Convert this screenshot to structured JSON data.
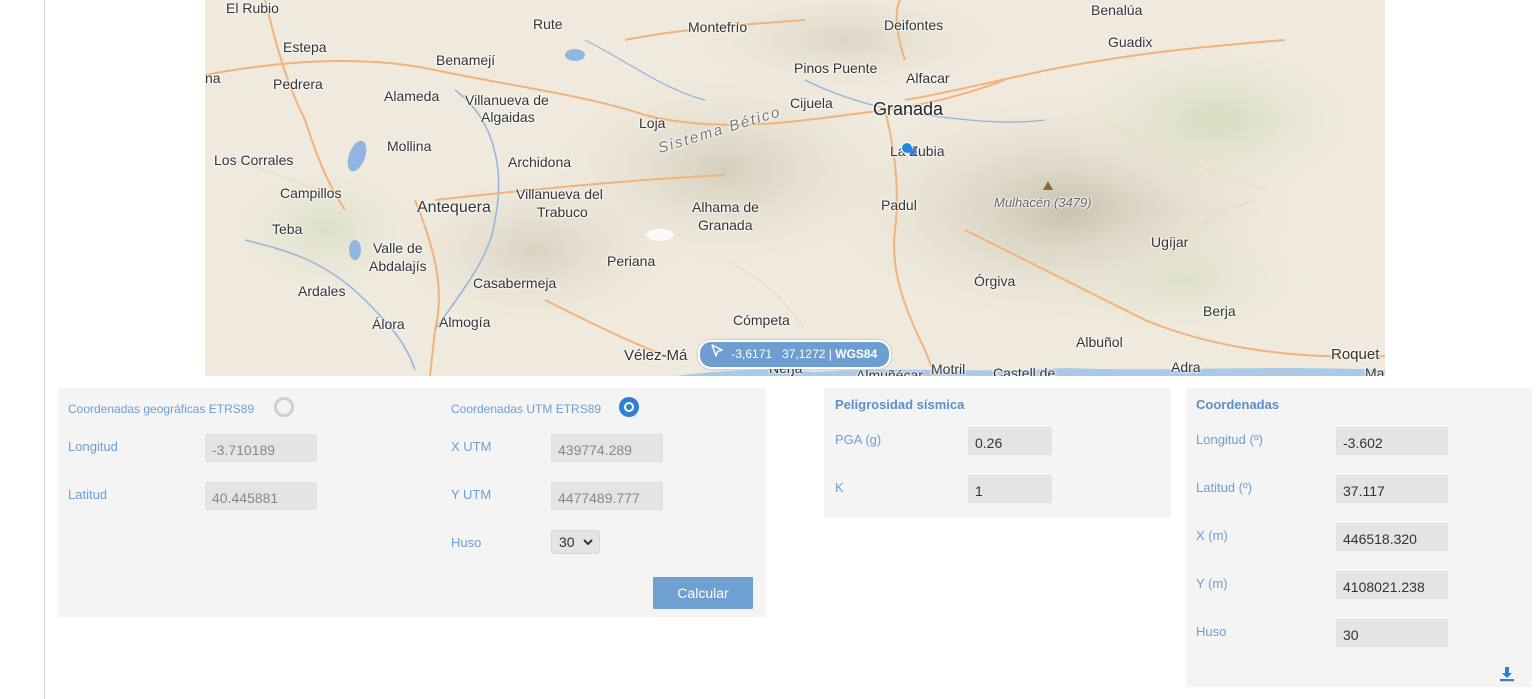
{
  "map": {
    "places": [
      {
        "name": "El Rubio",
        "style": "normal"
      },
      {
        "name": "Rute",
        "style": "normal"
      },
      {
        "name": "Montefrío",
        "style": "normal"
      },
      {
        "name": "Deifontes",
        "style": "normal"
      },
      {
        "name": "Benalúa",
        "style": "normal"
      },
      {
        "name": "Guadix",
        "style": "normal"
      },
      {
        "name": "Estepa",
        "style": "normal"
      },
      {
        "name": "Benamejí",
        "style": "normal"
      },
      {
        "name": "na",
        "style": "normal"
      },
      {
        "name": "Pedrera",
        "style": "normal"
      },
      {
        "name": "Alameda",
        "style": "normal"
      },
      {
        "name": "Villanueva de",
        "style": "normal"
      },
      {
        "name": "Algaidas",
        "style": "normal"
      },
      {
        "name": "Pinos Puente",
        "style": "normal"
      },
      {
        "name": "Alfacar",
        "style": "normal"
      },
      {
        "name": "Cijuela",
        "style": "normal"
      },
      {
        "name": "Granada",
        "style": "big"
      },
      {
        "name": "Loja",
        "style": "normal"
      },
      {
        "name": "Sistema Bético",
        "style": "region"
      },
      {
        "name": "Mollina",
        "style": "normal"
      },
      {
        "name": "La Zubia",
        "style": "normal"
      },
      {
        "name": "Los Corrales",
        "style": "normal"
      },
      {
        "name": "Archidona",
        "style": "normal"
      },
      {
        "name": "Campillos",
        "style": "normal"
      },
      {
        "name": "Villanueva del",
        "style": "normal"
      },
      {
        "name": "Trabuco",
        "style": "normal"
      },
      {
        "name": "Antequera",
        "style": "normal"
      },
      {
        "name": "Alhama de",
        "style": "normal"
      },
      {
        "name": "Granada",
        "style": "normal"
      },
      {
        "name": "Padul",
        "style": "normal"
      },
      {
        "name": "Mulhacén (3479)",
        "style": "peak"
      },
      {
        "name": "Teba",
        "style": "normal"
      },
      {
        "name": "Ugíjar",
        "style": "normal"
      },
      {
        "name": "Valle de",
        "style": "normal"
      },
      {
        "name": "Abdalajís",
        "style": "normal"
      },
      {
        "name": "Periana",
        "style": "normal"
      },
      {
        "name": "Casabermeja",
        "style": "normal"
      },
      {
        "name": "Órgiva",
        "style": "normal"
      },
      {
        "name": "Ardales",
        "style": "normal"
      },
      {
        "name": "Berja",
        "style": "normal"
      },
      {
        "name": "Álora",
        "style": "normal"
      },
      {
        "name": "Almogía",
        "style": "normal"
      },
      {
        "name": "Cómpeta",
        "style": "normal"
      },
      {
        "name": "Albuñol",
        "style": "normal"
      },
      {
        "name": "Vélez-Má",
        "style": "normal"
      },
      {
        "name": "Nerja",
        "style": "normal"
      },
      {
        "name": "Almuñécar",
        "style": "normal"
      },
      {
        "name": "Motril",
        "style": "normal"
      },
      {
        "name": "Castell de",
        "style": "normal"
      },
      {
        "name": "Adra",
        "style": "normal"
      },
      {
        "name": "Roquet",
        "style": "normal"
      },
      {
        "name": "Ma",
        "style": "normal"
      }
    ],
    "cursor_coords": {
      "lon": "-3,6171",
      "lat": "37,1272",
      "separator": "|",
      "crs": "WGS84"
    }
  },
  "converter": {
    "geo_radio_label": "Coordenadas geográficas ETRS89",
    "geo_selected": false,
    "utm_radio_label": "Coordenadas UTM ETRS89",
    "utm_selected": true,
    "longitud_label": "Longitud",
    "longitud_value": "-3.710189",
    "latitud_label": "Latitud",
    "latitud_value": "40.445881",
    "xutm_label": "X UTM",
    "xutm_value": "439774.289",
    "yutm_label": "Y UTM",
    "yutm_value": "4477489.777",
    "huso_label": "Huso",
    "huso_value": "30",
    "calc_button": "Calcular"
  },
  "seismic": {
    "title": "Peligrosidad sísmica",
    "pga_label": "PGA (g)",
    "pga_value": "0.26",
    "k_label": "K",
    "k_value": "1"
  },
  "coords": {
    "title": "Coordenadas",
    "lon_label": "Longitud (º)",
    "lon_value": "-3.602",
    "lat_label": "Latitud (º)",
    "lat_value": "37.117",
    "x_label": "X (m)",
    "x_value": "446518.320",
    "y_label": "Y (m)",
    "y_value": "4108021.238",
    "huso_label": "Huso",
    "huso_value": "30"
  },
  "icons": {
    "download": "download-icon",
    "cursor": "cursor-arrow-icon",
    "chevron": "chevron-down-icon"
  },
  "colors": {
    "accent": "#6fa0d2",
    "label": "#6c9ed4",
    "panel_bg": "#f4f4f4",
    "field_bg": "#e4e4e4"
  }
}
